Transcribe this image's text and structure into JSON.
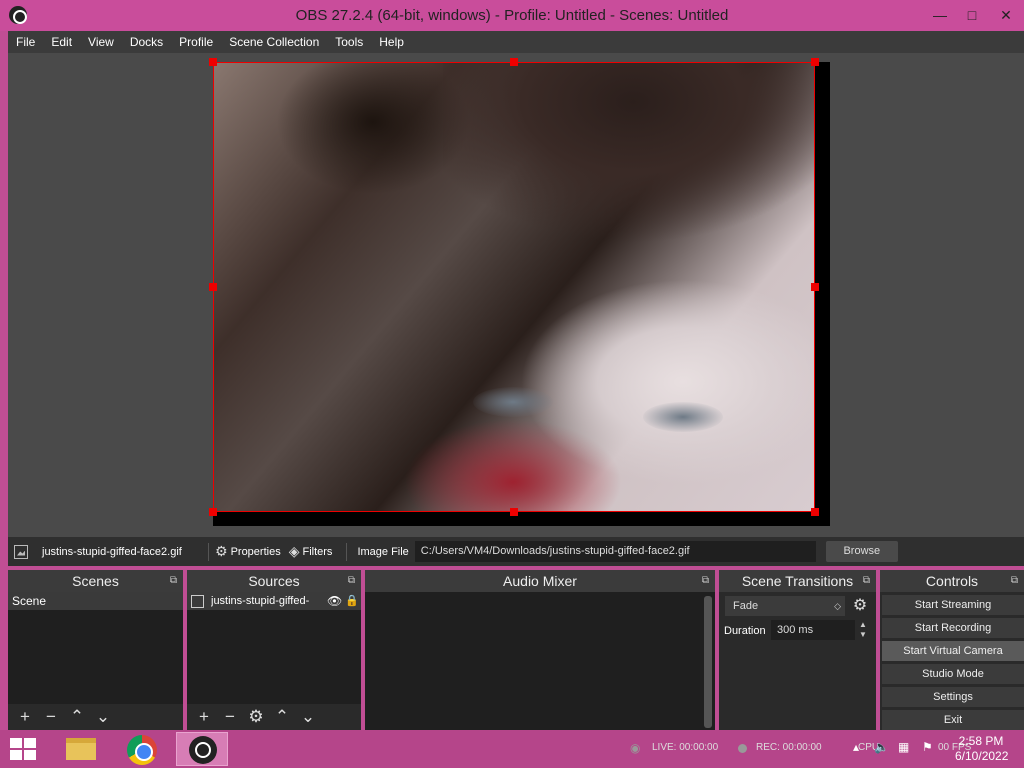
{
  "window": {
    "title": "OBS 27.2.4 (64-bit, windows) - Profile: Untitled - Scenes: Untitled",
    "min": "—",
    "max": "□",
    "close": "✕"
  },
  "menu": [
    "File",
    "Edit",
    "View",
    "Docks",
    "Profile",
    "Scene Collection",
    "Tools",
    "Help"
  ],
  "source_toolbar": {
    "source_name": "justins-stupid-giffed-face2.gif",
    "properties_label": "Properties",
    "filters_label": "Filters",
    "image_file_label": "Image File",
    "file_path": "C:/Users/VM4/Downloads/justins-stupid-giffed-face2.gif",
    "browse_label": "Browse"
  },
  "docks": {
    "scenes": {
      "title": "Scenes",
      "items": [
        "Scene"
      ]
    },
    "sources": {
      "title": "Sources",
      "items": [
        "justins-stupid-giffed-"
      ]
    },
    "audio": {
      "title": "Audio Mixer"
    },
    "transitions": {
      "title": "Scene Transitions",
      "selected": "Fade",
      "duration_label": "Duration",
      "duration_value": "300 ms"
    },
    "controls": {
      "title": "Controls",
      "buttons": [
        "Start Streaming",
        "Start Recording",
        "Start Virtual Camera",
        "Studio Mode",
        "Settings",
        "Exit"
      ]
    }
  },
  "status_bar": {
    "live": "LIVE: 00:00:00",
    "rec": "REC: 00:00:00",
    "cpu": "CPU:",
    "fps": "00 FPS"
  },
  "clock": {
    "time": "2:58 PM",
    "date": "6/10/2022"
  },
  "colors": {
    "title_bar": "#c94d9b",
    "taskbar": "#b5458a",
    "selection": "#ee0000"
  }
}
